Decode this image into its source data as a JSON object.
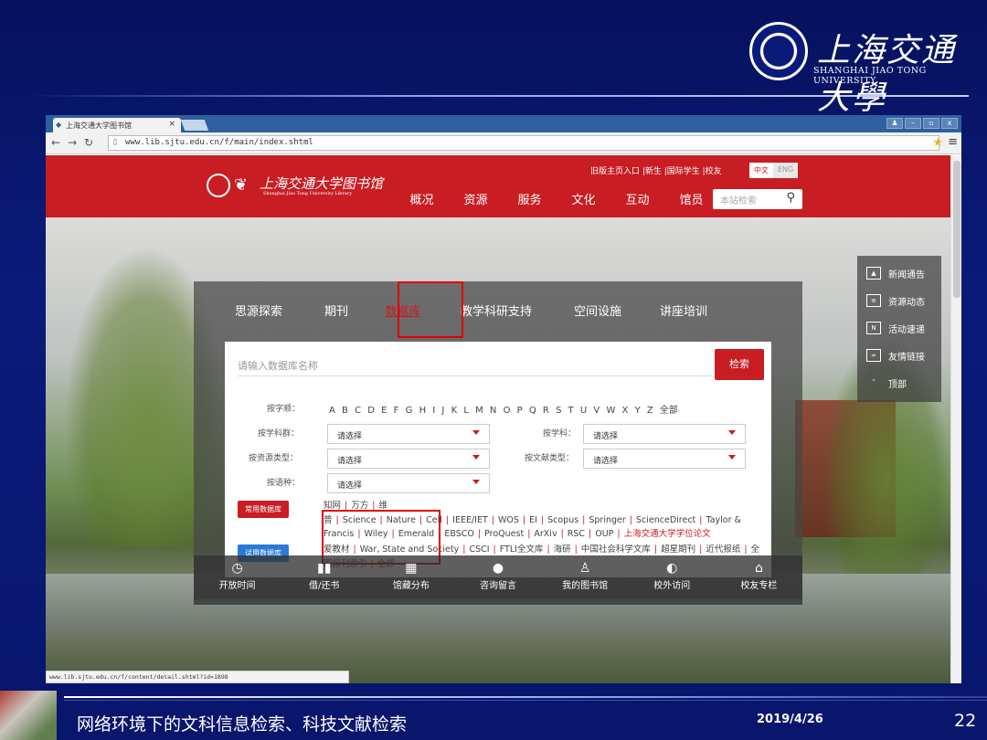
{
  "slide": {
    "logo_cn": "上海交通大學",
    "logo_en": "SHANGHAI JIAO TONG UNIVERSITY",
    "footer_title": "网络环境下的文科信息检索、科技文献检索",
    "footer_date": "2019/4/26",
    "page_number": "22"
  },
  "browser": {
    "tab_title": "上海交通大学图书馆",
    "tab_close": "×",
    "url": "www.lib.sjtu.edu.cn/f/main/index.shtml",
    "status_url": "www.lib.sjtu.edu.cn/f/content/detail.shtml?id=1898"
  },
  "header": {
    "logo_text": "上海交通大学图书馆",
    "logo_sub": "Shanghai Jiao Tong University Library",
    "top_links": "旧版主页入口 |新生 |国际学生 |校友",
    "lang_cn": "中文",
    "lang_en": "ENG",
    "nav": [
      "概况",
      "资源",
      "服务",
      "文化",
      "互动",
      "馆员"
    ],
    "search_placeholder": "本站检索"
  },
  "panel": {
    "tabs": [
      "思源探索",
      "期刊",
      "数据库",
      "教学科研支持",
      "空间设施",
      "讲座培训"
    ],
    "active_tab": 2,
    "search_placeholder": "请输入数据库名称",
    "search_button": "检索",
    "label_letter": "按字顺：",
    "letters": [
      "A",
      "B",
      "C",
      "D",
      "E",
      "F",
      "G",
      "H",
      "I",
      "J",
      "K",
      "L",
      "M",
      "N",
      "O",
      "P",
      "Q",
      "R",
      "S",
      "T",
      "U",
      "V",
      "W",
      "X",
      "Y",
      "Z",
      "全部"
    ],
    "label_subject_group": "按学科群：",
    "label_subject": "按学科：",
    "label_resource_type": "按资源类型：",
    "label_doc_type": "按文献类型：",
    "label_language": "按语种：",
    "select_default": "请选择",
    "common_badge": "常用数据库",
    "trial_badge": "试用数据库",
    "common_dbs": [
      "知网",
      "万方",
      "维普",
      "Science",
      "Nature",
      "Cell",
      "IEEE/IET",
      "WOS",
      "EI",
      "Scopus",
      "Springer",
      "ScienceDirect",
      "Taylor & Francis",
      "Wiley",
      "Emerald",
      "EBSCO",
      "ProQuest",
      "ArXiv",
      "RSC",
      "OUP"
    ],
    "common_highlight": "上海交通大学学位论文",
    "trial_dbs": [
      "爱教材",
      "War, State and Society",
      "CSCI",
      "FTLI全文库",
      "海研",
      "中国社会科学文库",
      "超星期刊",
      "近代报纸",
      "全国报刊索引",
      "全部"
    ]
  },
  "side": [
    "新闻通告",
    "资源动态",
    "活动速递",
    "友情链接",
    "顶部"
  ],
  "bottom": [
    "开放时间",
    "借/还书",
    "馆藏分布",
    "咨询留言",
    "我的图书馆",
    "校外访问",
    "校友专栏"
  ],
  "colors": {
    "brand_red": "#c81d22",
    "slide_blue": "#0a1a7a"
  }
}
